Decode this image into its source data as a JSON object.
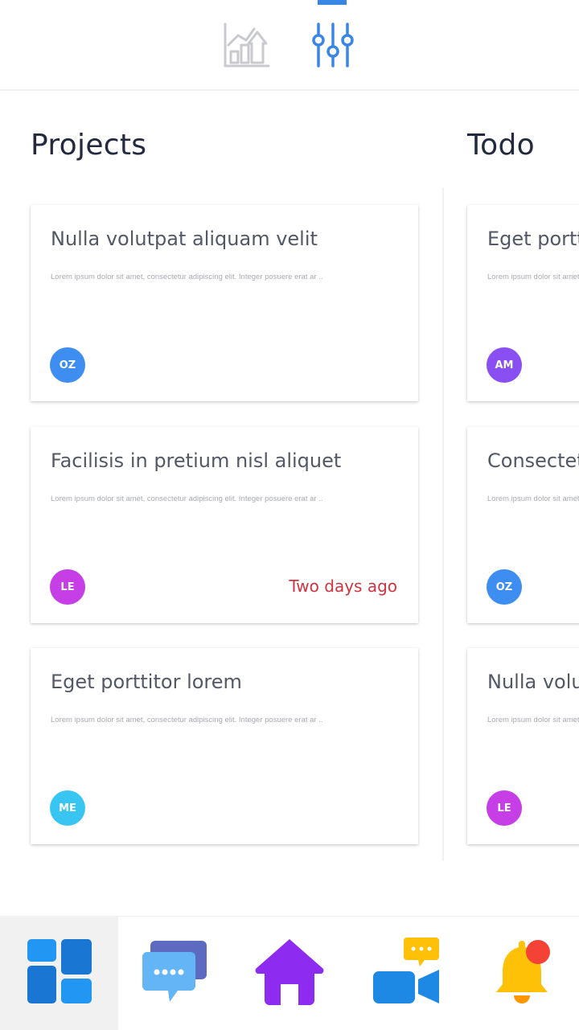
{
  "columns": [
    {
      "title": "Projects",
      "cards": [
        {
          "title": "Nulla volutpat aliquam velit",
          "description": "Lorem ipsum dolor sit amet, consectetur adipiscing elit. Integer posuere erat ar ..",
          "avatar": "OZ",
          "avatar_color": "#3d8ef0",
          "due": ""
        },
        {
          "title": "Facilisis in pretium nisl aliquet",
          "description": "Lorem ipsum dolor sit amet, consectetur adipiscing elit. Integer posuere erat ar ..",
          "avatar": "LE",
          "avatar_color": "#c53ee6",
          "due": "Two days ago"
        },
        {
          "title": "Eget porttitor lorem",
          "description": "Lorem ipsum dolor sit amet, consectetur adipiscing elit. Integer posuere erat ar ..",
          "avatar": "ME",
          "avatar_color": "#38c5f2",
          "due": ""
        }
      ]
    },
    {
      "title": "Todo",
      "cards": [
        {
          "title": "Eget porttitor lorem",
          "description": "Lorem ipsum dolor sit amet, consectetur adipiscing elit. Integer posuere erat ar ..",
          "avatar": "AM",
          "avatar_color": "#8a4ff2",
          "due": ""
        },
        {
          "title": "Consectetur",
          "description": "Lorem ipsum dolor sit amet, consectetur adipiscing elit. Integer posuere erat ar ..",
          "avatar": "OZ",
          "avatar_color": "#3d8ef0",
          "due": ""
        },
        {
          "title": "Nulla volutpat aliquam velit",
          "description": "Lorem ipsum dolor sit amet, consectetur adipiscing elit. Integer posuere erat ar ..",
          "avatar": "LE",
          "avatar_color": "#c53ee6",
          "due": ""
        }
      ]
    }
  ],
  "top_tabs": [
    {
      "icon": "analytics-chart-icon",
      "active": false
    },
    {
      "icon": "filter-sliders-icon",
      "active": true
    }
  ],
  "bottom_nav": [
    {
      "icon": "dashboard-grid-icon",
      "active": true
    },
    {
      "icon": "chat-bubbles-icon",
      "active": false
    },
    {
      "icon": "home-icon",
      "active": false
    },
    {
      "icon": "video-call-icon",
      "active": false
    },
    {
      "icon": "notification-bell-icon",
      "active": false,
      "has_badge": true
    }
  ],
  "colors": {
    "accent": "#3a86e4",
    "due": "#d13440"
  }
}
